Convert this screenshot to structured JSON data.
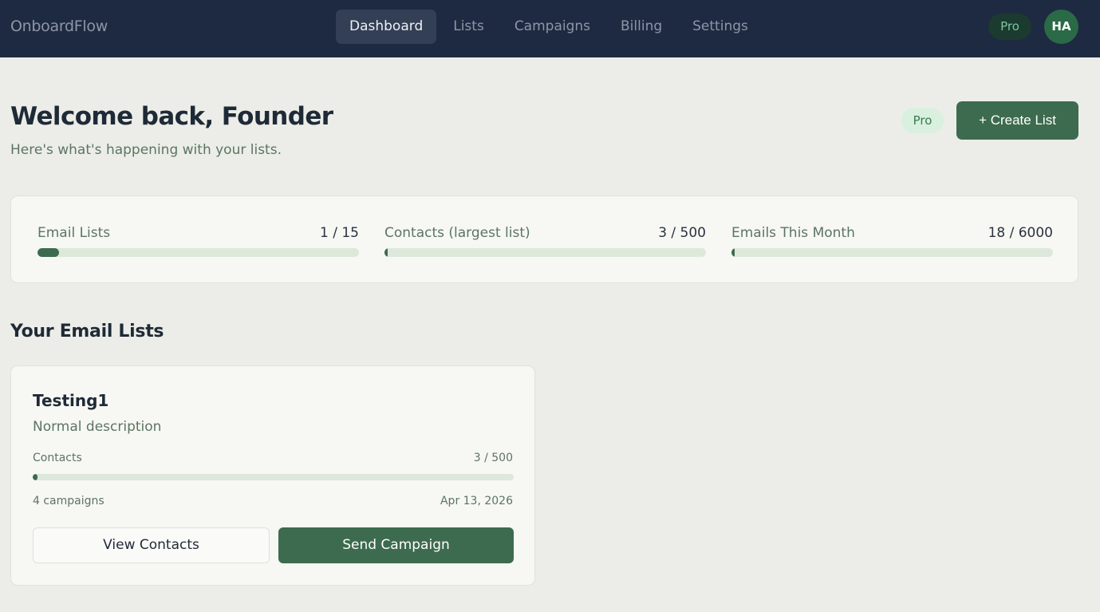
{
  "app": {
    "brand": "OnboardFlow",
    "nav": [
      {
        "label": "Dashboard",
        "active": true
      },
      {
        "label": "Lists",
        "active": false
      },
      {
        "label": "Campaigns",
        "active": false
      },
      {
        "label": "Billing",
        "active": false
      },
      {
        "label": "Settings",
        "active": false
      }
    ],
    "plan_badge": "Pro",
    "avatar_initials": "HA"
  },
  "header": {
    "title": "Welcome back, Founder",
    "subtitle": "Here's what's happening with your lists.",
    "plan_badge": "Pro",
    "create_button": "+ Create List"
  },
  "usage": [
    {
      "label": "Email Lists",
      "value": "1 / 15",
      "fraction": 0.0667
    },
    {
      "label": "Contacts (largest list)",
      "value": "3 / 500",
      "fraction": 0.006
    },
    {
      "label": "Emails This Month",
      "value": "18 / 6000",
      "fraction": 0.003
    }
  ],
  "lists_section": {
    "title": "Your Email Lists",
    "lists": [
      {
        "name": "Testing1",
        "description": "Normal description",
        "contacts_label": "Contacts",
        "contacts_value": "3 / 500",
        "contacts_fraction": 0.006,
        "campaigns": "4 campaigns",
        "date": "Apr 13, 2026",
        "view_button": "View Contacts",
        "send_button": "Send Campaign"
      }
    ]
  },
  "colors": {
    "nav_bg": "#1e2a42",
    "page_bg": "#ecede8",
    "accent": "#3d6b4f",
    "progress_track": "#dde8da"
  }
}
